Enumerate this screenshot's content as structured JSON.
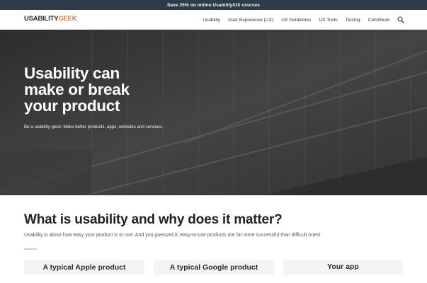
{
  "promo": {
    "text": "Save 25% on online Usability/UX courses"
  },
  "header": {
    "logo": {
      "main": "USABILITY",
      "accent": "GEEK",
      "sub": ""
    },
    "nav": [
      {
        "label": "Usability"
      },
      {
        "label": "User Experience (UX)"
      },
      {
        "label": "UX Guidelines"
      },
      {
        "label": "UX Tools"
      },
      {
        "label": "Testing"
      },
      {
        "label": "Contribute"
      }
    ],
    "search_icon": "search-icon"
  },
  "hero": {
    "title_lines": [
      "Usability can",
      "make or break",
      "your product"
    ],
    "subtitle": "Be a usability geek: Make better products, apps, websites and services."
  },
  "section": {
    "title": "What is usability and why does it matter?",
    "text": "Usability is about how easy your product is to use. And you guessed it, easy-to-use products are far more successful than difficult ones!"
  },
  "cards": [
    {
      "label": "A typical Apple product"
    },
    {
      "label": "A typical Google product"
    },
    {
      "label": "Your app"
    }
  ],
  "colors": {
    "promo_bg": "#2f3a4a",
    "accent": "#e8744a",
    "hero_bg": "#3b3b3b",
    "card_bg": "#f4f4f4"
  }
}
